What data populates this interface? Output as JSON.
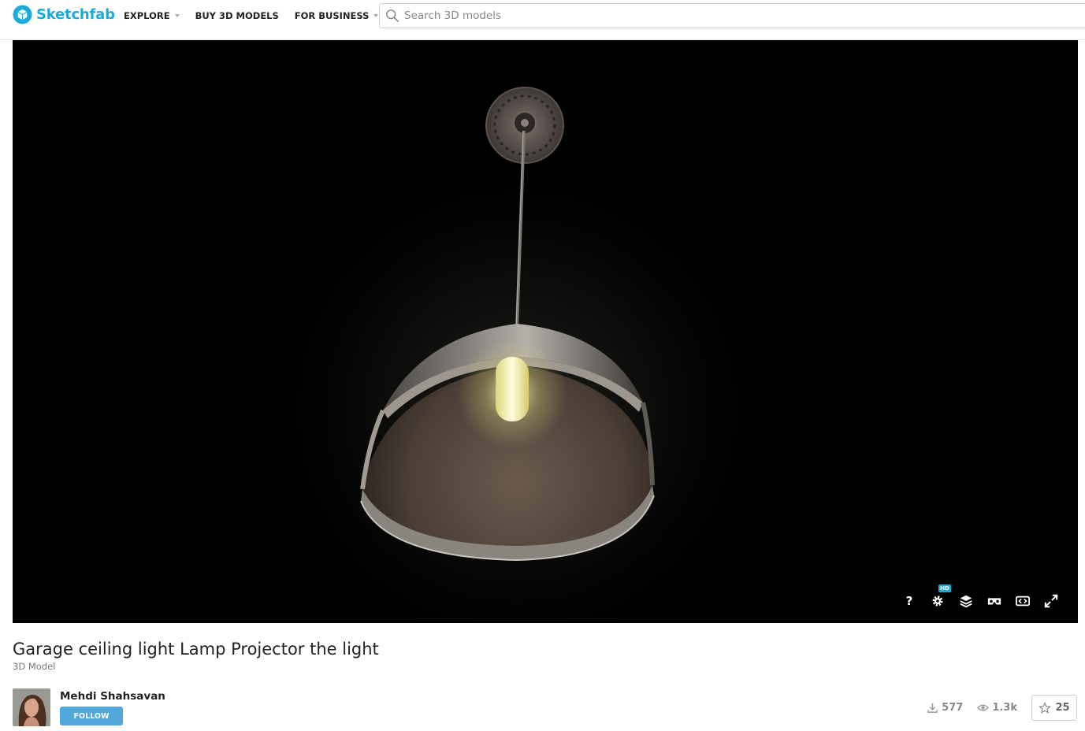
{
  "brand": {
    "name": "Sketchfab",
    "color": "#1caad9"
  },
  "nav": {
    "explore": "EXPLORE",
    "buy": "BUY 3D MODELS",
    "business": "FOR BUSINESS"
  },
  "search": {
    "placeholder": "Search 3D models"
  },
  "viewer": {
    "controls": {
      "help": "?",
      "hd_badge": "HD"
    },
    "icons": [
      "help-icon",
      "settings-icon",
      "layers-icon",
      "vr-icon",
      "embed-icon",
      "fullscreen-icon"
    ]
  },
  "model": {
    "title": "Garage ceiling light Lamp Projector the light",
    "type": "3D Model"
  },
  "author": {
    "name": "Mehdi Shahsavan",
    "follow_label": "FOLLOW"
  },
  "stats": {
    "downloads": "577",
    "views": "1.3k",
    "likes": "25"
  }
}
